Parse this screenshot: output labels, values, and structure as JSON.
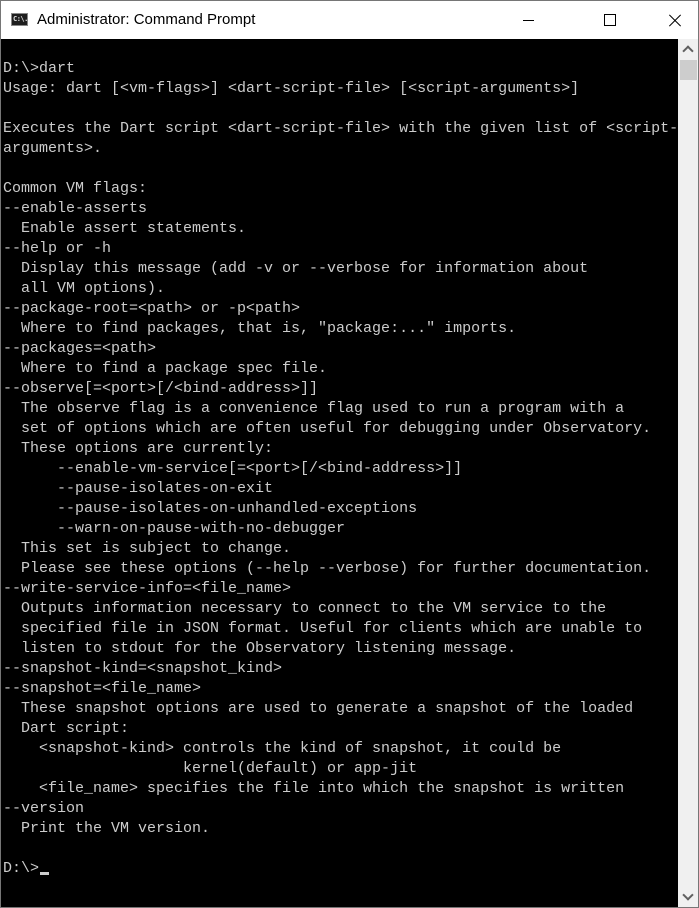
{
  "window": {
    "title": "Administrator: Command Prompt",
    "app_icon_text": "C:\\.",
    "controls": {
      "minimize": "minimize",
      "maximize": "maximize",
      "close": "close"
    }
  },
  "console": {
    "colors": {
      "background": "#000000",
      "foreground": "#cccccc"
    },
    "lines": [
      "D:\\>dart",
      "Usage: dart [<vm-flags>] <dart-script-file> [<script-arguments>]",
      "",
      "Executes the Dart script <dart-script-file> with the given list of <script-",
      "arguments>.",
      "",
      "Common VM flags:",
      "--enable-asserts",
      "  Enable assert statements.",
      "--help or -h",
      "  Display this message (add -v or --verbose for information about",
      "  all VM options).",
      "--package-root=<path> or -p<path>",
      "  Where to find packages, that is, \"package:...\" imports.",
      "--packages=<path>",
      "  Where to find a package spec file.",
      "--observe[=<port>[/<bind-address>]]",
      "  The observe flag is a convenience flag used to run a program with a",
      "  set of options which are often useful for debugging under Observatory.",
      "  These options are currently:",
      "      --enable-vm-service[=<port>[/<bind-address>]]",
      "      --pause-isolates-on-exit",
      "      --pause-isolates-on-unhandled-exceptions",
      "      --warn-on-pause-with-no-debugger",
      "  This set is subject to change.",
      "  Please see these options (--help --verbose) for further documentation.",
      "--write-service-info=<file_name>",
      "  Outputs information necessary to connect to the VM service to the",
      "  specified file in JSON format. Useful for clients which are unable to",
      "  listen to stdout for the Observatory listening message.",
      "--snapshot-kind=<snapshot_kind>",
      "--snapshot=<file_name>",
      "  These snapshot options are used to generate a snapshot of the loaded",
      "  Dart script:",
      "    <snapshot-kind> controls the kind of snapshot, it could be",
      "                    kernel(default) or app-jit",
      "    <file_name> specifies the file into which the snapshot is written",
      "--version",
      "  Print the VM version.",
      ""
    ],
    "prompt": "D:\\>",
    "input": ""
  },
  "scrollbar": {
    "position": "bottom",
    "up_icon": "chevron-up-icon",
    "down_icon": "chevron-down-icon"
  }
}
